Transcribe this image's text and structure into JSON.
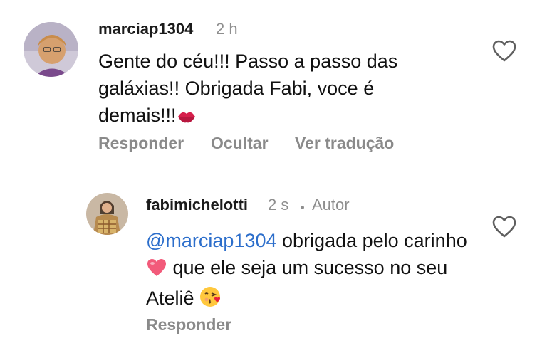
{
  "comments": [
    {
      "username": "marciap1304",
      "time": "2 h",
      "text": "Gente do céu!!! Passo a passo das galáxias!! Obrigada Fabi, voce é demais!!!",
      "emoji": "kiss-mark",
      "actions": [
        "Responder",
        "Ocultar",
        "Ver tradução"
      ]
    },
    {
      "username": "fabimichelotti",
      "time": "2 s",
      "badge": "Autor",
      "mention": "@marciap1304",
      "text_part1": "obrigada pelo carinho",
      "text_part2": "que ele seja um sucesso no seu Ateliê",
      "emoji1": "pink-heart",
      "emoji2": "face-blowing-kiss",
      "actions": [
        "Responder"
      ]
    }
  ],
  "colors": {
    "mention": "#2c6ecb",
    "secondary": "#8e8e8e",
    "text": "#111111"
  }
}
